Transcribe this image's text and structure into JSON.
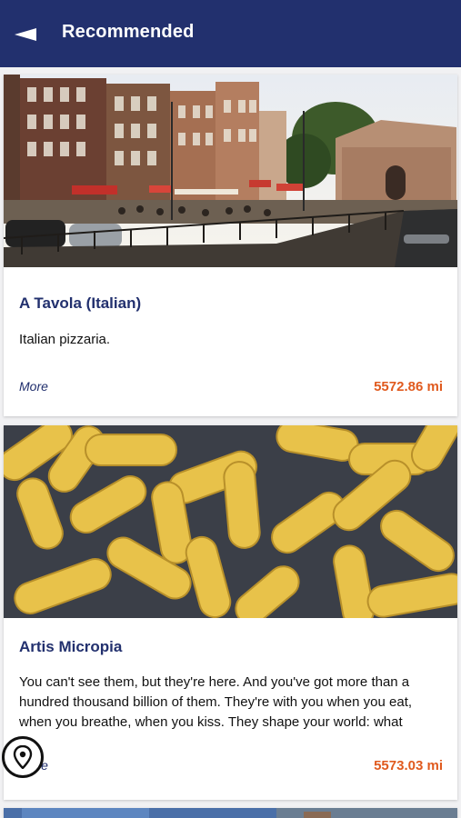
{
  "header": {
    "title": "Recommended",
    "back_icon": "back-arrow-icon",
    "bg_color": "#22306e"
  },
  "cards": [
    {
      "image": "canal-street-amsterdam-photo",
      "title": "A Tavola (Italian)",
      "description": "Italian pizzaria.",
      "more_label": "More",
      "distance": "5572.86 mi"
    },
    {
      "image": "yellow-microbes-photo",
      "title": "Artis Micropia",
      "description": "You can't see them, but they're here. And you've got more than a hundred thousand billion of them. They're with you when you eat, when you breathe, when you kiss. They shape your world: what",
      "more_label": "More",
      "distance": "5573.03 mi"
    },
    {
      "image": "partial-card-photo"
    }
  ],
  "map_button": {
    "icon": "map-pin-icon"
  },
  "colors": {
    "accent": "#22306e",
    "distance": "#e05a1e",
    "background": "#f1f1f3"
  }
}
